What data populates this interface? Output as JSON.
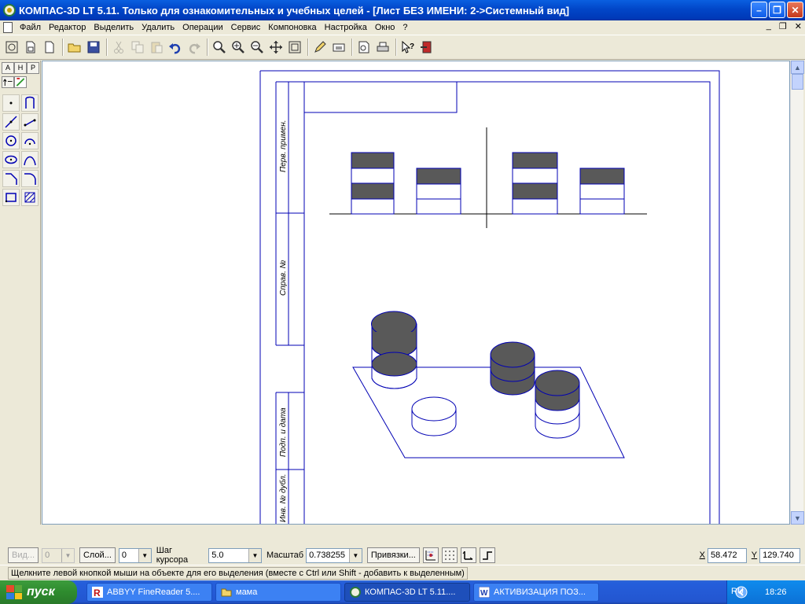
{
  "window": {
    "title": "КОМПАС-3D LT 5.11. Только для ознакомительных и учебных целей - [Лист БЕЗ ИМЕНИ: 2->Системный вид]"
  },
  "menu": {
    "items": [
      "Файл",
      "Редактор",
      "Выделить",
      "Удалить",
      "Операции",
      "Сервис",
      "Компоновка",
      "Настройка",
      "Окно",
      "?"
    ]
  },
  "leftpanel": {
    "tabs": [
      "A",
      "H",
      "P"
    ]
  },
  "drawing": {
    "stamp_labels": [
      "Перв. примен.",
      "Справ. №",
      "Подп. и дата",
      "Инв. № дубл."
    ]
  },
  "propbar": {
    "view_label": "Вид...",
    "view_value": "0",
    "layer_button": "Слой...",
    "layer_value": "0",
    "step_label": "Шаг курсора",
    "step_value": "5.0",
    "scale_label": "Масштаб",
    "scale_value": "0.738255",
    "snaps_button": "Привязки...",
    "x_label": "X",
    "x_value": "58.472",
    "y_label": "Y",
    "y_value": "129.740"
  },
  "status": {
    "text": "Щелкните левой кнопкой мыши на объекте для его выделения (вместе с Ctrl или Shift - добавить к выделенным)"
  },
  "taskbar": {
    "start": "пуск",
    "tasks": [
      {
        "label": "ABBYY FineReader 5....",
        "active": false
      },
      {
        "label": "мама",
        "active": false
      },
      {
        "label": "КОМПАС-3D LT 5.11....",
        "active": true
      },
      {
        "label": "АКТИВИЗАЦИЯ ПОЗ...",
        "active": false
      }
    ],
    "lang": "RU",
    "clock": "18:26"
  },
  "colors": {
    "drawing_line": "#0000b4",
    "fill_gray": "#595959",
    "xp_blue": "#0a5fe0"
  }
}
